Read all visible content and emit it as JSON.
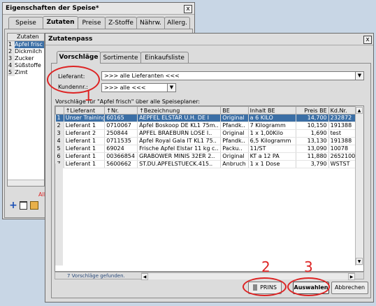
{
  "back_window": {
    "title": "Eigenschaften der Speise*",
    "close_label": "x",
    "tabs": [
      "Speise",
      "Zutaten",
      "Preise",
      "Z-Stoffe",
      "Nährw.",
      "Allerg."
    ],
    "active_tab": 1,
    "list_header": "Zutaten",
    "list_items": [
      "Apfel frisc",
      "Dickmilch",
      "Zucker",
      "Süßstoffe",
      "Zimt"
    ],
    "red_text": "All"
  },
  "front_window": {
    "title": "Zutatenpass",
    "close_label": "x",
    "tabs": [
      "Vorschläge",
      "Sortimente",
      "Einkaufsliste"
    ],
    "active_tab": 0,
    "lieferant_label": "Lieferant:",
    "lieferant_value": ">>> alle Lieferanten <<<",
    "kundennr_label": "Kundennr.:",
    "kundennr_value": ">>> alle <<<",
    "grid_caption": "Vorschläge für \"Apfel frisch\" über alle Speiseplaner:",
    "columns": [
      "",
      "Lieferant",
      "Nr.",
      "Bezeichnung",
      "BE",
      "Inhalt BE",
      "Preis BE",
      "Kd.Nr."
    ],
    "sort_marks": [
      "",
      "↑",
      "↑",
      "↑",
      "",
      "",
      "",
      ""
    ],
    "rows": [
      [
        "1",
        "Unser Training..",
        "60165",
        "AEPFEL ELSTAR U.H. DE I",
        "Original",
        "a 6 KILO",
        "14,700",
        "232872"
      ],
      [
        "2",
        "Lieferant 1",
        "0710067",
        "Äpfel Boskoop DE KL1 75m..",
        "Pfandk..",
        "7 Kilogramm",
        "10,150",
        "191388"
      ],
      [
        "3",
        "Lieferant 2",
        "250844",
        "APFEL BRAEBURN LOSE I..",
        "Original",
        "1 x 1,00Kilo",
        "1,690",
        "test"
      ],
      [
        "4",
        "Lieferant 1",
        "0711535",
        "Äpfel Royal Gala IT KL1 75..",
        "Pfandk..",
        "6,5 Kilogramm",
        "13,130",
        "191388"
      ],
      [
        "5",
        "Lieferant 1",
        "69024",
        "Frische Apfel Elstar 11 kg c..",
        "Packu..",
        "11/ST",
        "13,090",
        "10078"
      ],
      [
        "6",
        "Lieferant 1",
        "00366854",
        "GRABOWER MINIS 32ER 2..",
        "Original",
        "KT a 12 PA",
        "11,880",
        "2652100"
      ],
      [
        "7",
        "Lieferant 1",
        "5600662",
        "ST.DU.APFELSTUECK.415..",
        "Anbruch",
        "1 x 1 Dose",
        "3,790",
        "WSTST"
      ]
    ],
    "status_text": "7 Vorschläge gefunden.",
    "buttons": {
      "print": "PRINS",
      "select": "Auswahlen",
      "cancel": "Abbrechen"
    }
  },
  "annotations": [
    "1",
    "2",
    "3"
  ],
  "colors": {
    "selection": "#3a6ea5",
    "annotation": "#dd2222",
    "desktop": "#c8d6e5"
  }
}
